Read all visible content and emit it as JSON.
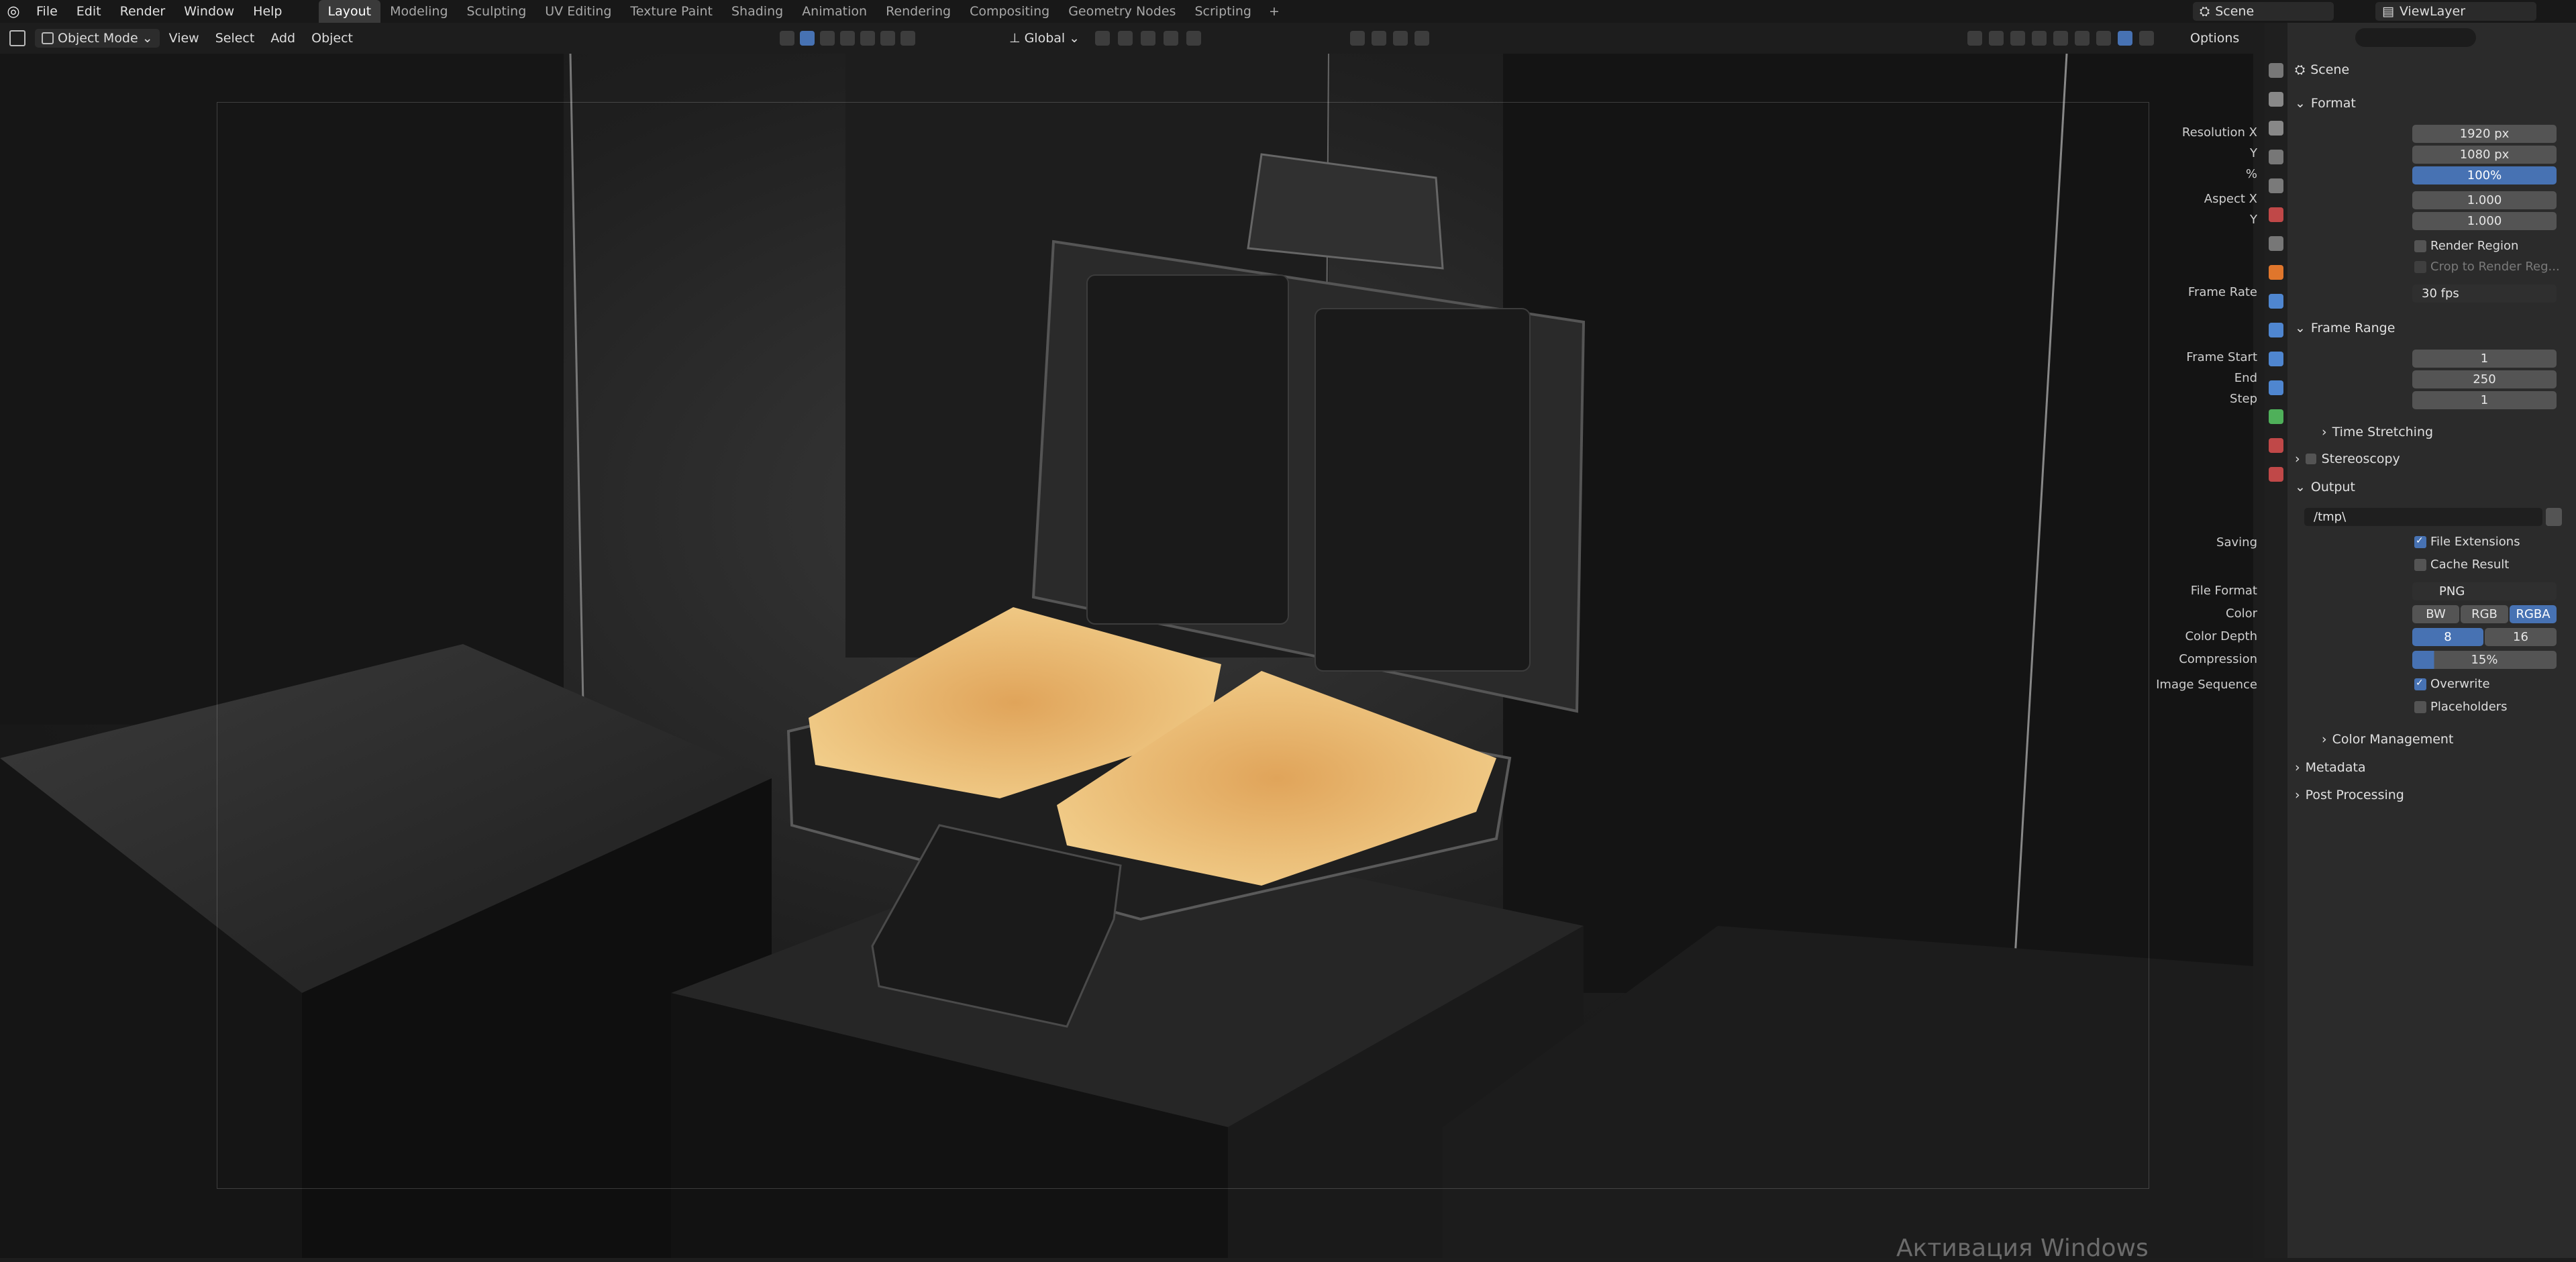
{
  "menu": [
    "File",
    "Edit",
    "Render",
    "Window",
    "Help"
  ],
  "workspaces": [
    "Layout",
    "Modeling",
    "Sculpting",
    "UV Editing",
    "Texture Paint",
    "Shading",
    "Animation",
    "Rendering",
    "Compositing",
    "Geometry Nodes",
    "Scripting"
  ],
  "active_workspace": "Layout",
  "scene_name": "Scene",
  "view_layer": "ViewLayer",
  "header": {
    "mode": "Object Mode",
    "view": "View",
    "select": "Select",
    "add": "Add",
    "object": "Object",
    "transform": "Global",
    "options": "Options"
  },
  "props": {
    "context": "Scene",
    "format": {
      "title": "Format",
      "res_x_label": "Resolution X",
      "res_x": "1920 px",
      "res_y_label": "Y",
      "res_y": "1080 px",
      "pct_label": "%",
      "pct": "100%",
      "aspect_x_label": "Aspect X",
      "aspect_x": "1.000",
      "aspect_y_label": "Y",
      "aspect_y": "1.000",
      "render_region": "Render Region",
      "crop": "Crop to Render Reg...",
      "frame_rate_label": "Frame Rate",
      "frame_rate": "30 fps"
    },
    "frame_range": {
      "title": "Frame Range",
      "start_label": "Frame Start",
      "start": "1",
      "end_label": "End",
      "end": "250",
      "step_label": "Step",
      "step": "1",
      "time_stretching": "Time Stretching"
    },
    "stereoscopy": "Stereoscopy",
    "output": {
      "title": "Output",
      "path": "/tmp\\",
      "saving_label": "Saving",
      "file_ext": "File Extensions",
      "cache": "Cache Result",
      "format_label": "File Format",
      "format": "PNG",
      "color_label": "Color",
      "color_opts": [
        "BW",
        "RGB",
        "RGBA"
      ],
      "depth_label": "Color Depth",
      "depth_opts": [
        "8",
        "16"
      ],
      "compression_label": "Compression",
      "compression": "15%",
      "img_seq_label": "Image Sequence",
      "overwrite": "Overwrite",
      "placeholders": "Placeholders",
      "color_mgmt": "Color Management"
    },
    "metadata": "Metadata",
    "post_processing": "Post Processing"
  },
  "watermark": "Активация Windows"
}
